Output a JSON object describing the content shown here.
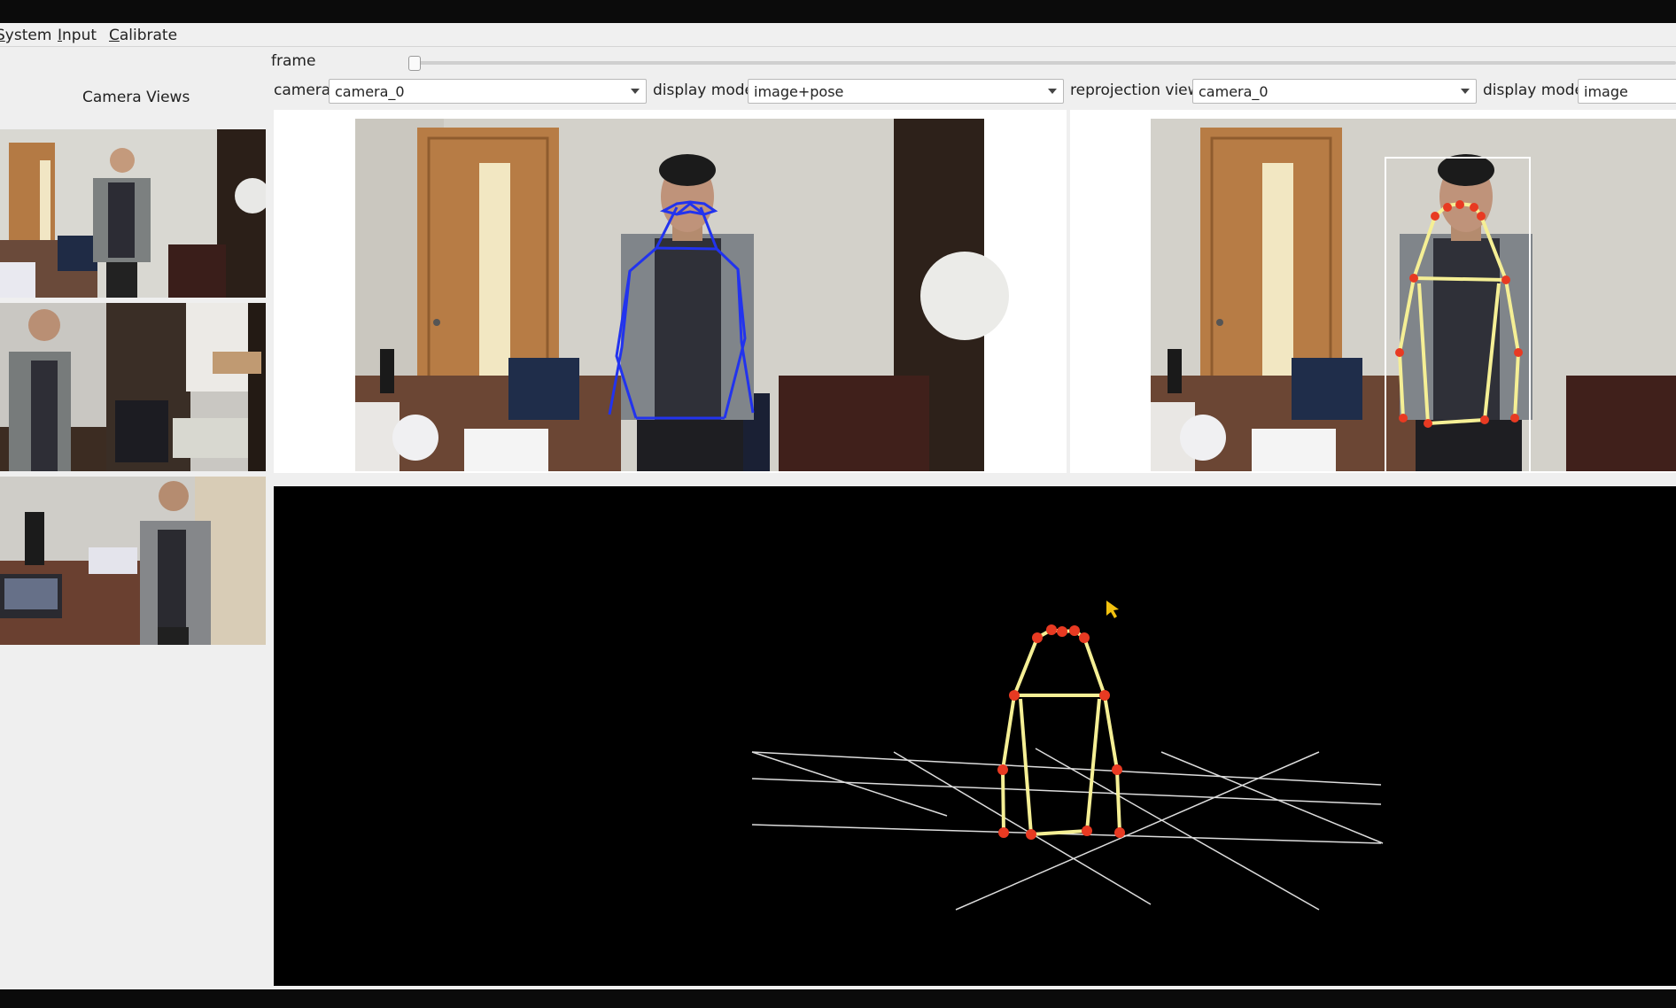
{
  "menu": {
    "items": [
      {
        "mnemonic": "S",
        "rest": "ystem"
      },
      {
        "mnemonic": "I",
        "rest": "nput"
      },
      {
        "mnemonic": "C",
        "rest": "alibrate"
      }
    ]
  },
  "left_panel": {
    "title": "Camera Views",
    "thumbnails": [
      "camera-view-1",
      "camera-view-2",
      "camera-view-3"
    ]
  },
  "frame": {
    "label": "frame",
    "position": 0
  },
  "left_view": {
    "camera_label": "camera",
    "camera_value": "camera_0",
    "display_mode_label": "display mode",
    "display_mode_value": "image+pose"
  },
  "right_view": {
    "reprojection_label": "reprojection view",
    "reprojection_value": "camera_0",
    "display_mode_label": "display mode",
    "display_mode_value": "image"
  },
  "colors": {
    "pose_2d": "#2233ee",
    "skeleton_3d": "#f5ef95",
    "joint": "#e83a22",
    "bbox": "#ffffff",
    "grid": "#dddddd",
    "cursor": "#f2c10f"
  }
}
